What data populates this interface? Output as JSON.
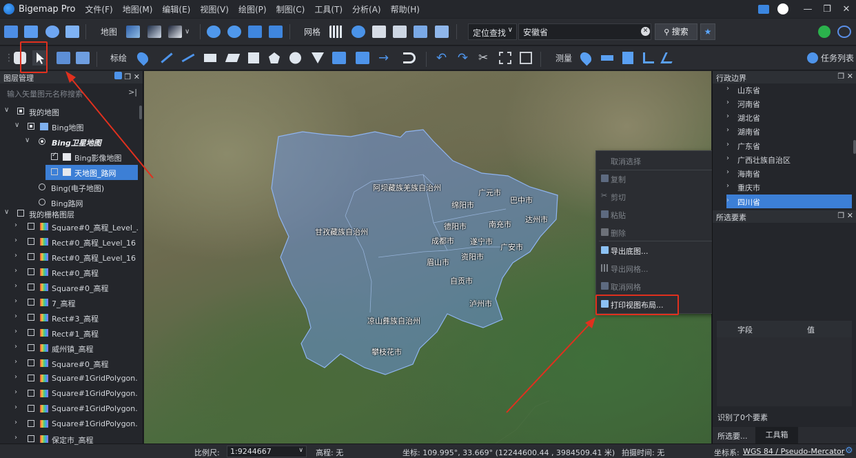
{
  "app": {
    "title": "Bigemap Pro"
  },
  "menu": [
    "文件(F)",
    "地图(M)",
    "编辑(E)",
    "视图(V)",
    "绘图(P)",
    "制图(C)",
    "工具(T)",
    "分析(A)",
    "帮助(H)"
  ],
  "window_controls": {
    "minimize": "—",
    "restore": "❐",
    "close": "✕"
  },
  "toolbar1": {
    "map_label": "地图",
    "grid_label": "网格",
    "locate_mode": "定位查找",
    "search_value": "安徽省",
    "search_button": "搜索",
    "clear_glyph": "✕",
    "fav_glyph": "★"
  },
  "toolbar2": {
    "annotate_label": "标绘",
    "measure_label": "测量",
    "task_list": "任务列表"
  },
  "layer_panel": {
    "title": "图层管理",
    "search_placeholder": "输入矢量图元名称搜索",
    "rows": [
      {
        "label": "我的地图"
      },
      {
        "label": "Bing地图"
      },
      {
        "label": "Bing卫星地图"
      },
      {
        "label": "Bing影像地图"
      },
      {
        "label": "天地图_路网"
      },
      {
        "label": "Bing(电子地图)"
      },
      {
        "label": "Bing路网"
      },
      {
        "label": "我的栅格图层"
      },
      {
        "label": "Square#0_高程_Level_..."
      },
      {
        "label": "Rect#0_高程_Level_16"
      },
      {
        "label": "Rect#0_高程_Level_16"
      },
      {
        "label": "Rect#0_高程"
      },
      {
        "label": "Square#0_高程"
      },
      {
        "label": "7_高程"
      },
      {
        "label": "Rect#3_高程"
      },
      {
        "label": "Rect#1_高程"
      },
      {
        "label": "威州镇_高程"
      },
      {
        "label": "Square#0_高程"
      },
      {
        "label": "Square#1GridPolygon..."
      },
      {
        "label": "Square#1GridPolygon..."
      },
      {
        "label": "Square#1GridPolygon..."
      },
      {
        "label": "Square#1GridPolygon..."
      },
      {
        "label": "保定市_高程"
      }
    ]
  },
  "map_labels": [
    "阿坝藏族羌族自治州",
    "广元市",
    "巴中市",
    "绵阳市",
    "甘孜藏族自治州",
    "南充市",
    "达州市",
    "德阳市",
    "成都市",
    "遂宁市",
    "广安市",
    "眉山市",
    "资阳市",
    "自贡市",
    "泸州市",
    "凉山彝族自治州",
    "攀枝花市"
  ],
  "context_menu": {
    "items": [
      {
        "label": "取消选择",
        "enabled": false
      },
      {
        "label": "复制",
        "enabled": false
      },
      {
        "label": "剪切",
        "enabled": false
      },
      {
        "label": "粘贴",
        "enabled": false
      },
      {
        "label": "删除",
        "enabled": false
      },
      {
        "label": "导出底图...",
        "enabled": true
      },
      {
        "label": "导出网格...",
        "enabled": false
      },
      {
        "label": "取消网格",
        "enabled": false
      },
      {
        "label": "打印视图布局...",
        "enabled": true
      }
    ]
  },
  "admin_panel": {
    "title": "行政边界",
    "items": [
      "山东省",
      "河南省",
      "湖北省",
      "湖南省",
      "广东省",
      "广西壮族自治区",
      "海南省",
      "重庆市",
      "四川省"
    ],
    "selected": "四川省"
  },
  "selected_features": {
    "title": "所选要素",
    "col_field": "字段",
    "col_value": "值",
    "status": "识别了0个要素"
  },
  "bottom_tabs": {
    "selected": "所选要...",
    "toolbox": "工具箱"
  },
  "status": {
    "scale_label": "比例尺:",
    "scale_value": "1:9244667",
    "elevation": "高程: 无",
    "coords": "坐标: 109.995°, 33.669° (12244600.44 , 3984509.41 米)",
    "capture_time": "拍摄时间: 无",
    "crs_label": "坐标系:",
    "crs_value": "WGS 84 / Pseudo-Mercator"
  },
  "colors": {
    "accent": "#3c7fd6",
    "annotation_red": "#e0301e",
    "sichuan_fill": "#6a8fd6"
  }
}
